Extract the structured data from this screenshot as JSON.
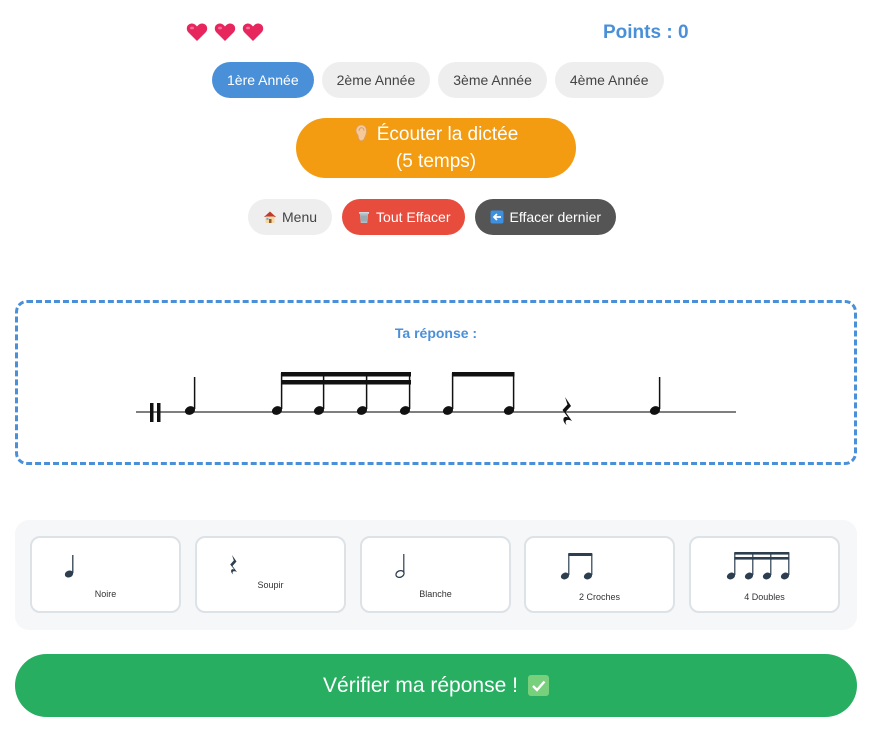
{
  "status": {
    "lives": 3,
    "points_label": "Points : 0"
  },
  "levels": [
    {
      "label": "1ère Année",
      "active": true
    },
    {
      "label": "2ème Année",
      "active": false
    },
    {
      "label": "3ème Année",
      "active": false
    },
    {
      "label": "4ème Année",
      "active": false
    }
  ],
  "listen": {
    "line1": "Écouter la dictée",
    "line2": "(5 temps)",
    "icon": "ear-icon"
  },
  "actions": {
    "menu_label": "Menu",
    "clear_label": "Tout Effacer",
    "undo_label": "Effacer dernier"
  },
  "answer": {
    "title": "Ta réponse :",
    "sequence": [
      "Noire",
      "4 Doubles",
      "2 Croches",
      "Soupir",
      "Noire"
    ]
  },
  "palette": [
    {
      "label": "Noire",
      "icon": "quarter-note-icon"
    },
    {
      "label": "Soupir",
      "icon": "quarter-rest-icon"
    },
    {
      "label": "Blanche",
      "icon": "half-note-icon"
    },
    {
      "label": "2 Croches",
      "icon": "two-eighths-icon"
    },
    {
      "label": "4 Doubles",
      "icon": "four-sixteenths-icon"
    }
  ],
  "verify": {
    "label": "Vérifier ma réponse !",
    "icon": "check-icon"
  },
  "colors": {
    "primary": "#4a90d9",
    "listen": "#f39c12",
    "danger": "#e74c3c",
    "dark": "#555555",
    "success": "#27ae60",
    "heart": "#e8265e"
  }
}
